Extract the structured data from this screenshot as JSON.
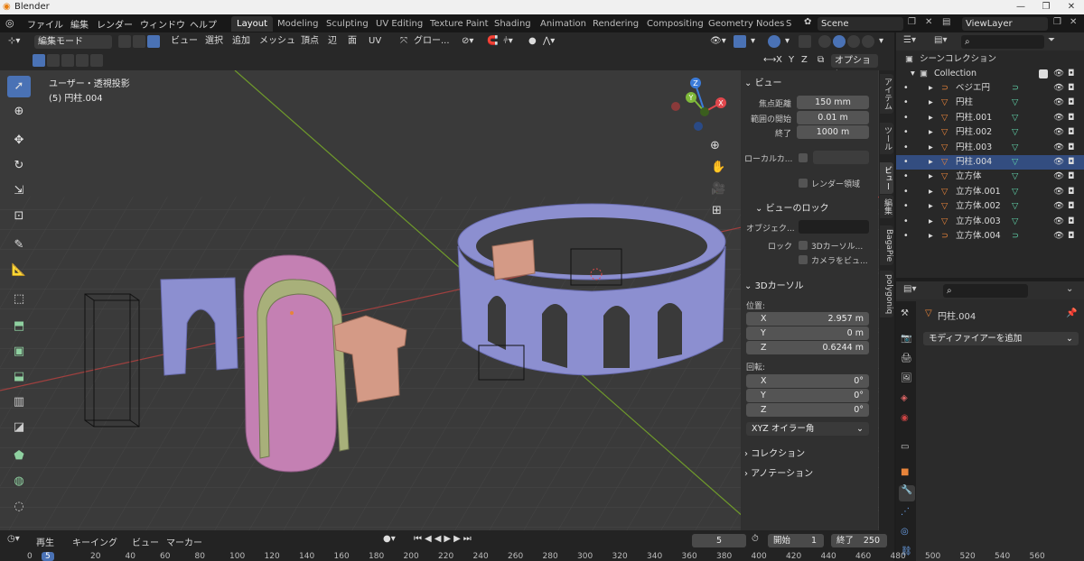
{
  "app": {
    "window_title": "Blender"
  },
  "topmenu": {
    "items": [
      "ファイル",
      "編集",
      "レンダー",
      "ウィンドウ",
      "ヘルプ"
    ],
    "workspaces": [
      "Layout",
      "Modeling",
      "Sculpting",
      "UV Editing",
      "Texture Paint",
      "Shading",
      "Animation",
      "Rendering",
      "Compositing",
      "Geometry Nodes",
      "S"
    ],
    "scene": "Scene",
    "viewlayer": "ViewLayer"
  },
  "viewport_header": {
    "mode": "編集モード",
    "menus": [
      "ビュー",
      "選択",
      "追加",
      "メッシュ",
      "頂点",
      "辺",
      "面",
      "UV"
    ],
    "transform_orientation": "グロー...",
    "axes": [
      "X",
      "Y",
      "Z"
    ],
    "options": "オプション"
  },
  "viewport": {
    "view_name": "ユーザー・透視投影",
    "object_name": "(5) 円柱.004",
    "gizmo_axes": [
      "X",
      "Y",
      "Z"
    ]
  },
  "npanel": {
    "view_section": "ビュー",
    "focal_label": "焦点距離",
    "focal_value": "150 mm",
    "clip_start_label": "範囲の開始",
    "clip_start_value": "0.01 m",
    "clip_end_label": "終了",
    "clip_end_value": "1000 m",
    "local_camera_label": "ローカルカ...",
    "render_region_label": "レンダー領域",
    "view_lock_section": "ビューのロック",
    "lock_object_label": "オブジェク...",
    "lock_label": "ロック",
    "lock_cursor_label": "3Dカーソル...",
    "lock_camera_label": "カメラをビュ...",
    "cursor_section": "3Dカーソル",
    "location_label": "位置:",
    "loc_x_label": "X",
    "loc_x": "2.957 m",
    "loc_y_label": "Y",
    "loc_y": "0 m",
    "loc_z_label": "Z",
    "loc_z": "0.6244 m",
    "rotation_label": "回転:",
    "rot_x_label": "X",
    "rot_x": "0°",
    "rot_y_label": "Y",
    "rot_y": "0°",
    "rot_z_label": "Z",
    "rot_z": "0°",
    "rotation_mode": "XYZ オイラー角",
    "collection_section": "コレクション",
    "annotation_section": "アノテーション"
  },
  "sidetabs": [
    "アイテム",
    "ツール",
    "ビュー",
    "編集",
    "BagaPie",
    "polygoniq"
  ],
  "outliner": {
    "scene_collection": "シーンコレクション",
    "collection": "Collection",
    "items": [
      {
        "name": "ベジエ円",
        "type": "curve",
        "selected": false
      },
      {
        "name": "円柱",
        "type": "mesh",
        "selected": false
      },
      {
        "name": "円柱.001",
        "type": "mesh",
        "selected": false
      },
      {
        "name": "円柱.002",
        "type": "mesh",
        "selected": false
      },
      {
        "name": "円柱.003",
        "type": "mesh",
        "selected": false
      },
      {
        "name": "円柱.004",
        "type": "mesh",
        "selected": true
      },
      {
        "name": "立方体",
        "type": "mesh",
        "selected": false
      },
      {
        "name": "立方体.001",
        "type": "mesh",
        "selected": false
      },
      {
        "name": "立方体.002",
        "type": "mesh",
        "selected": false
      },
      {
        "name": "立方体.003",
        "type": "mesh",
        "selected": false
      },
      {
        "name": "立方体.004",
        "type": "curve",
        "selected": false
      }
    ]
  },
  "properties": {
    "object_name": "円柱.004",
    "add_modifier": "モディファイアーを追加"
  },
  "timeline": {
    "menus": [
      "再生",
      "キーイング",
      "ビュー",
      "マーカー"
    ],
    "current_frame": "5",
    "start_label": "開始",
    "start": "1",
    "end_label": "終了",
    "end": "250",
    "ticks": [
      "0",
      "5",
      "20",
      "40",
      "60",
      "80",
      "100",
      "120",
      "140",
      "160",
      "180",
      "200",
      "220",
      "240",
      "260",
      "280",
      "300",
      "320",
      "340",
      "360",
      "380",
      "400",
      "420",
      "440",
      "460",
      "480",
      "500",
      "520",
      "540",
      "560"
    ]
  },
  "colors": {
    "accent": "#4a72b5",
    "selection": "#334d80",
    "mesh_orange": "#e8843a",
    "vertex_green": "#5fd1a8",
    "x_axis": "#e0474c",
    "y_axis": "#7fb93a",
    "z_axis": "#3b7bd9"
  }
}
